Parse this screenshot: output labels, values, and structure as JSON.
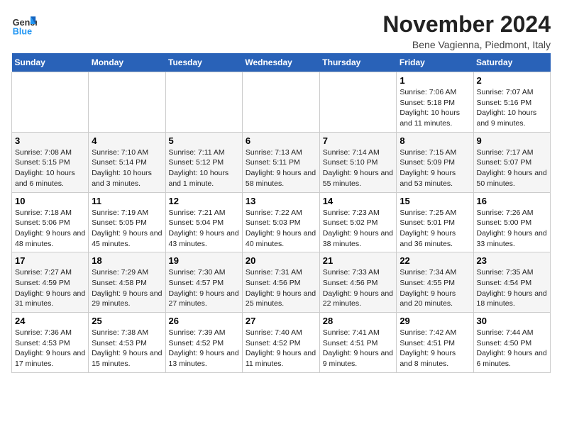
{
  "logo": {
    "text_general": "General",
    "text_blue": "Blue"
  },
  "header": {
    "month_year": "November 2024",
    "location": "Bene Vagienna, Piedmont, Italy"
  },
  "days_of_week": [
    "Sunday",
    "Monday",
    "Tuesday",
    "Wednesday",
    "Thursday",
    "Friday",
    "Saturday"
  ],
  "weeks": [
    [
      {
        "day": "",
        "info": ""
      },
      {
        "day": "",
        "info": ""
      },
      {
        "day": "",
        "info": ""
      },
      {
        "day": "",
        "info": ""
      },
      {
        "day": "",
        "info": ""
      },
      {
        "day": "1",
        "info": "Sunrise: 7:06 AM\nSunset: 5:18 PM\nDaylight: 10 hours and 11 minutes."
      },
      {
        "day": "2",
        "info": "Sunrise: 7:07 AM\nSunset: 5:16 PM\nDaylight: 10 hours and 9 minutes."
      }
    ],
    [
      {
        "day": "3",
        "info": "Sunrise: 7:08 AM\nSunset: 5:15 PM\nDaylight: 10 hours and 6 minutes."
      },
      {
        "day": "4",
        "info": "Sunrise: 7:10 AM\nSunset: 5:14 PM\nDaylight: 10 hours and 3 minutes."
      },
      {
        "day": "5",
        "info": "Sunrise: 7:11 AM\nSunset: 5:12 PM\nDaylight: 10 hours and 1 minute."
      },
      {
        "day": "6",
        "info": "Sunrise: 7:13 AM\nSunset: 5:11 PM\nDaylight: 9 hours and 58 minutes."
      },
      {
        "day": "7",
        "info": "Sunrise: 7:14 AM\nSunset: 5:10 PM\nDaylight: 9 hours and 55 minutes."
      },
      {
        "day": "8",
        "info": "Sunrise: 7:15 AM\nSunset: 5:09 PM\nDaylight: 9 hours and 53 minutes."
      },
      {
        "day": "9",
        "info": "Sunrise: 7:17 AM\nSunset: 5:07 PM\nDaylight: 9 hours and 50 minutes."
      }
    ],
    [
      {
        "day": "10",
        "info": "Sunrise: 7:18 AM\nSunset: 5:06 PM\nDaylight: 9 hours and 48 minutes."
      },
      {
        "day": "11",
        "info": "Sunrise: 7:19 AM\nSunset: 5:05 PM\nDaylight: 9 hours and 45 minutes."
      },
      {
        "day": "12",
        "info": "Sunrise: 7:21 AM\nSunset: 5:04 PM\nDaylight: 9 hours and 43 minutes."
      },
      {
        "day": "13",
        "info": "Sunrise: 7:22 AM\nSunset: 5:03 PM\nDaylight: 9 hours and 40 minutes."
      },
      {
        "day": "14",
        "info": "Sunrise: 7:23 AM\nSunset: 5:02 PM\nDaylight: 9 hours and 38 minutes."
      },
      {
        "day": "15",
        "info": "Sunrise: 7:25 AM\nSunset: 5:01 PM\nDaylight: 9 hours and 36 minutes."
      },
      {
        "day": "16",
        "info": "Sunrise: 7:26 AM\nSunset: 5:00 PM\nDaylight: 9 hours and 33 minutes."
      }
    ],
    [
      {
        "day": "17",
        "info": "Sunrise: 7:27 AM\nSunset: 4:59 PM\nDaylight: 9 hours and 31 minutes."
      },
      {
        "day": "18",
        "info": "Sunrise: 7:29 AM\nSunset: 4:58 PM\nDaylight: 9 hours and 29 minutes."
      },
      {
        "day": "19",
        "info": "Sunrise: 7:30 AM\nSunset: 4:57 PM\nDaylight: 9 hours and 27 minutes."
      },
      {
        "day": "20",
        "info": "Sunrise: 7:31 AM\nSunset: 4:56 PM\nDaylight: 9 hours and 25 minutes."
      },
      {
        "day": "21",
        "info": "Sunrise: 7:33 AM\nSunset: 4:56 PM\nDaylight: 9 hours and 22 minutes."
      },
      {
        "day": "22",
        "info": "Sunrise: 7:34 AM\nSunset: 4:55 PM\nDaylight: 9 hours and 20 minutes."
      },
      {
        "day": "23",
        "info": "Sunrise: 7:35 AM\nSunset: 4:54 PM\nDaylight: 9 hours and 18 minutes."
      }
    ],
    [
      {
        "day": "24",
        "info": "Sunrise: 7:36 AM\nSunset: 4:53 PM\nDaylight: 9 hours and 17 minutes."
      },
      {
        "day": "25",
        "info": "Sunrise: 7:38 AM\nSunset: 4:53 PM\nDaylight: 9 hours and 15 minutes."
      },
      {
        "day": "26",
        "info": "Sunrise: 7:39 AM\nSunset: 4:52 PM\nDaylight: 9 hours and 13 minutes."
      },
      {
        "day": "27",
        "info": "Sunrise: 7:40 AM\nSunset: 4:52 PM\nDaylight: 9 hours and 11 minutes."
      },
      {
        "day": "28",
        "info": "Sunrise: 7:41 AM\nSunset: 4:51 PM\nDaylight: 9 hours and 9 minutes."
      },
      {
        "day": "29",
        "info": "Sunrise: 7:42 AM\nSunset: 4:51 PM\nDaylight: 9 hours and 8 minutes."
      },
      {
        "day": "30",
        "info": "Sunrise: 7:44 AM\nSunset: 4:50 PM\nDaylight: 9 hours and 6 minutes."
      }
    ]
  ]
}
